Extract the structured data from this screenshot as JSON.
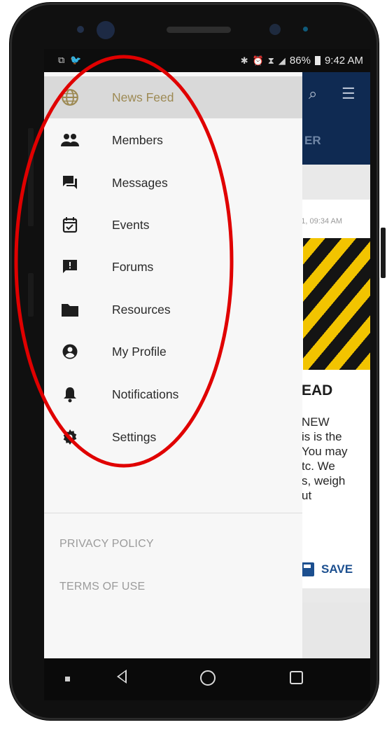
{
  "status_bar": {
    "left_icons": [
      "cast-icon",
      "twitter-icon"
    ],
    "battery": "86%",
    "time": "9:42 AM"
  },
  "background_app": {
    "tab_partial": "ER",
    "timestamp_partial": "11, 09:34 AM",
    "headline_partial": "EAD",
    "body_lines": [
      "NEW",
      "is is the",
      "You may",
      "tc.  We",
      "s, weigh",
      "ut"
    ],
    "save_label": "SAVE"
  },
  "drawer": {
    "items": [
      {
        "label": "News Feed",
        "icon": "globe-icon",
        "active": true
      },
      {
        "label": "Members",
        "icon": "people-icon",
        "active": false
      },
      {
        "label": "Messages",
        "icon": "forum-icon",
        "active": false
      },
      {
        "label": "Events",
        "icon": "calendar-check-icon",
        "active": false
      },
      {
        "label": "Forums",
        "icon": "feedback-icon",
        "active": false
      },
      {
        "label": "Resources",
        "icon": "folder-icon",
        "active": false
      },
      {
        "label": "My Profile",
        "icon": "account-circle-icon",
        "active": false
      },
      {
        "label": "Notifications",
        "icon": "bell-icon",
        "active": false
      },
      {
        "label": "Settings",
        "icon": "gear-icon",
        "active": false
      }
    ],
    "footer_links": [
      "PRIVACY POLICY",
      "TERMS OF USE"
    ]
  },
  "colors": {
    "accent_active": "#9d8a54",
    "app_header": "#0f2a52",
    "annotation": "#e00000"
  }
}
